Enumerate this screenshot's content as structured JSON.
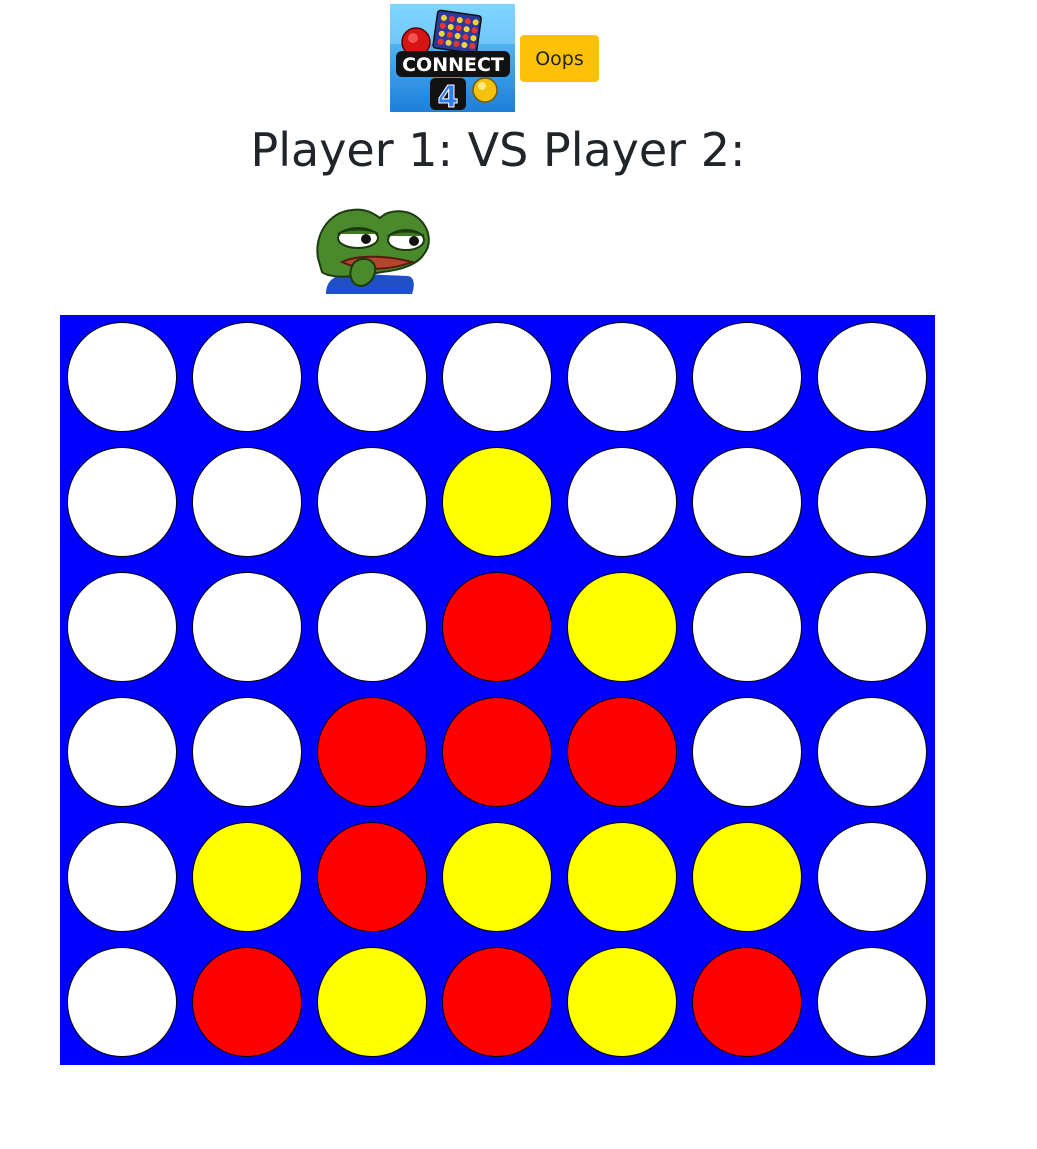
{
  "header": {
    "oops_label": "Oops"
  },
  "players": {
    "player1_label": "Player 1:",
    "vs_label": "VS",
    "player2_label": "Player 2:"
  },
  "images": {
    "logo": "connect-4-logo",
    "avatar": "pepe-thinking-avatar"
  },
  "colors": {
    "board": "#0000ff",
    "empty": "#ffffff",
    "red": "#ff0000",
    "yellow": "#ffff00",
    "oops_button": "#ffc107"
  },
  "board": {
    "rows": 6,
    "columns": 7,
    "cells": [
      [
        "empty",
        "empty",
        "empty",
        "empty",
        "empty",
        "empty",
        "empty"
      ],
      [
        "empty",
        "empty",
        "empty",
        "yellow",
        "empty",
        "empty",
        "empty"
      ],
      [
        "empty",
        "empty",
        "empty",
        "red",
        "yellow",
        "empty",
        "empty"
      ],
      [
        "empty",
        "empty",
        "red",
        "red",
        "red",
        "empty",
        "empty"
      ],
      [
        "empty",
        "yellow",
        "red",
        "yellow",
        "yellow",
        "yellow",
        "empty"
      ],
      [
        "empty",
        "red",
        "yellow",
        "red",
        "yellow",
        "red",
        "empty"
      ]
    ]
  }
}
